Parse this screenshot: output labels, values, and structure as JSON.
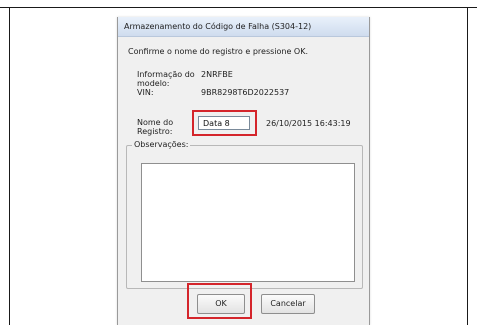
{
  "dialog": {
    "title": "Armazenamento do Código de Falha (S304-12)",
    "instruction": "Confirme o nome do registro e pressione OK.",
    "model_label": "Informação do modelo:",
    "model_value": "2NRFBE",
    "vin_label": "VIN:",
    "vin_value": "9BR8298T6D2022537",
    "record_name_label": "Nome do Registro:",
    "record_name_value": "Data 8",
    "record_datetime": "26/10/2015 16:43:19",
    "observations_label": "Observações:",
    "observations_value": "",
    "ok_label": "OK",
    "cancel_label": "Cancelar"
  },
  "colors": {
    "highlight": "#d4252b",
    "titlebar": "#cfdcee",
    "dialog_bg": "#f0f0f0"
  }
}
